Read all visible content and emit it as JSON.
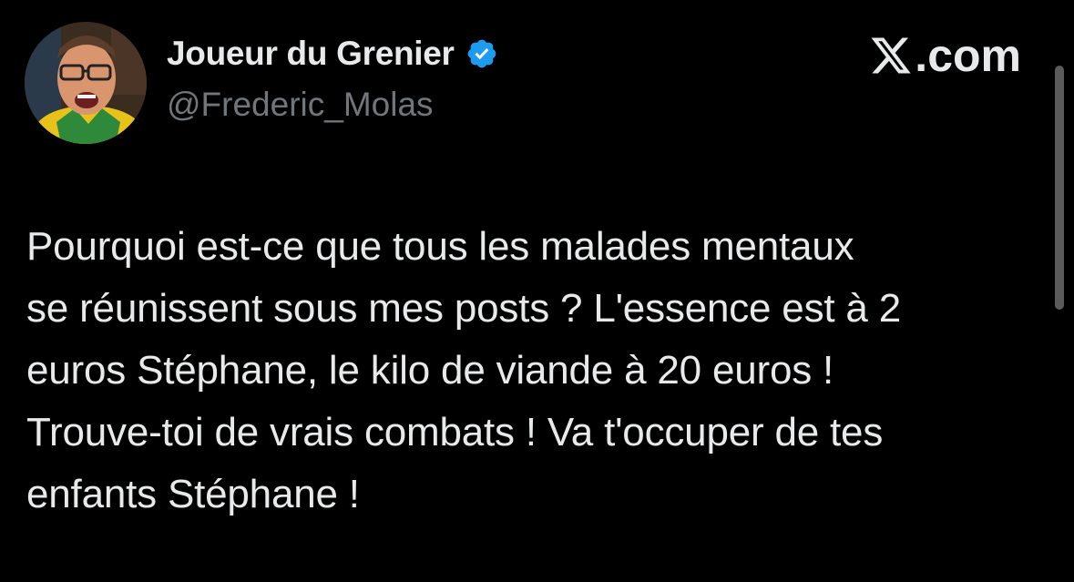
{
  "brand": {
    "label": ".com",
    "logo_icon": "x-logo-icon"
  },
  "author": {
    "display_name": "Joueur du Grenier",
    "handle": "@Frederic_Molas",
    "verified_icon": "verified-badge-icon",
    "verified_color": "#1d9bf0",
    "avatar_icon": "avatar-photo"
  },
  "tweet": {
    "text": "Pourquoi est-ce que tous les malades mentaux\nse réunissent sous mes posts ? L'essence est à 2\neuros Stéphane, le kilo de viande à 20 euros !\nTrouve-toi de vrais combats ! Va t'occuper de tes\nenfants Stéphane !"
  },
  "colors": {
    "background": "#000000",
    "text_primary": "#e7e9ea",
    "text_secondary": "#71767b"
  }
}
